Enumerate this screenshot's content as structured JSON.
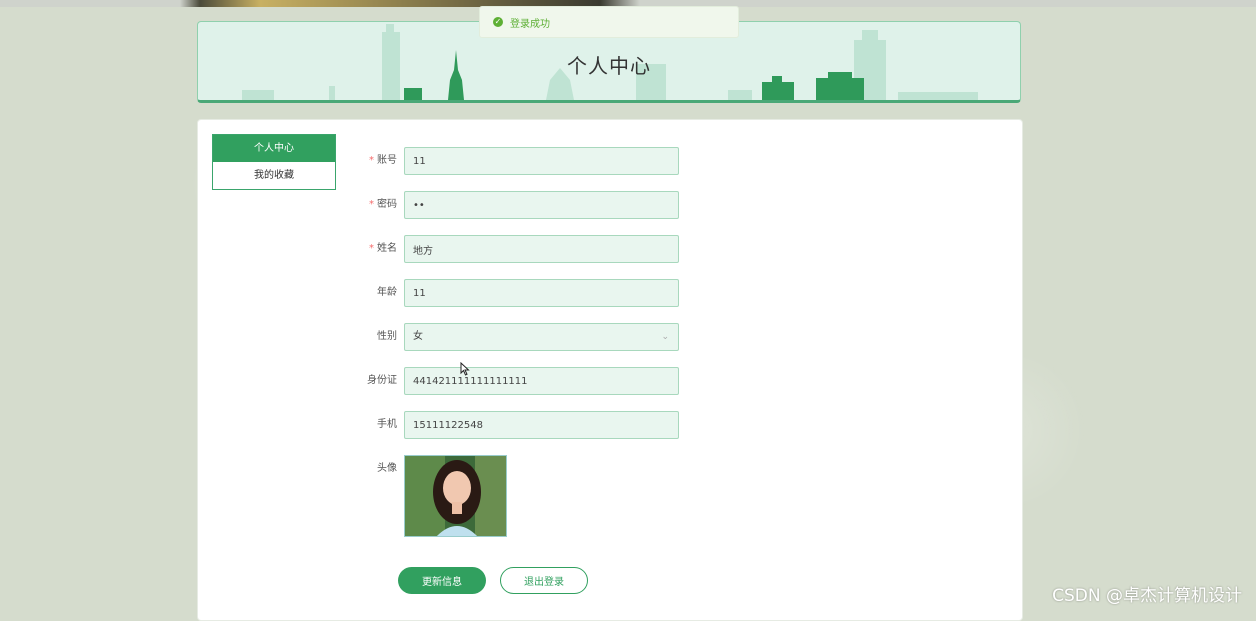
{
  "toast": {
    "message": "登录成功"
  },
  "header": {
    "title": "个人中心"
  },
  "sidebar": {
    "items": [
      {
        "label": "个人中心",
        "active": true
      },
      {
        "label": "我的收藏",
        "active": false
      }
    ]
  },
  "form": {
    "account": {
      "label": "账号",
      "value": "11",
      "required": true
    },
    "password": {
      "label": "密码",
      "value": "••",
      "required": true
    },
    "name": {
      "label": "姓名",
      "value": "地方",
      "required": true
    },
    "age": {
      "label": "年龄",
      "value": "11"
    },
    "gender": {
      "label": "性别",
      "value": "女"
    },
    "idcard": {
      "label": "身份证",
      "value": "441421111111111111"
    },
    "phone": {
      "label": "手机",
      "value": "15111122548"
    },
    "avatar": {
      "label": "头像"
    }
  },
  "actions": {
    "update_label": "更新信息",
    "logout_label": "退出登录"
  },
  "watermark": "CSDN @卓杰计算机设计",
  "colors": {
    "primary": "#31a05f",
    "field_bg": "#e9f6ef",
    "banner_bg": "#dff2ea",
    "success": "#5daf34"
  }
}
